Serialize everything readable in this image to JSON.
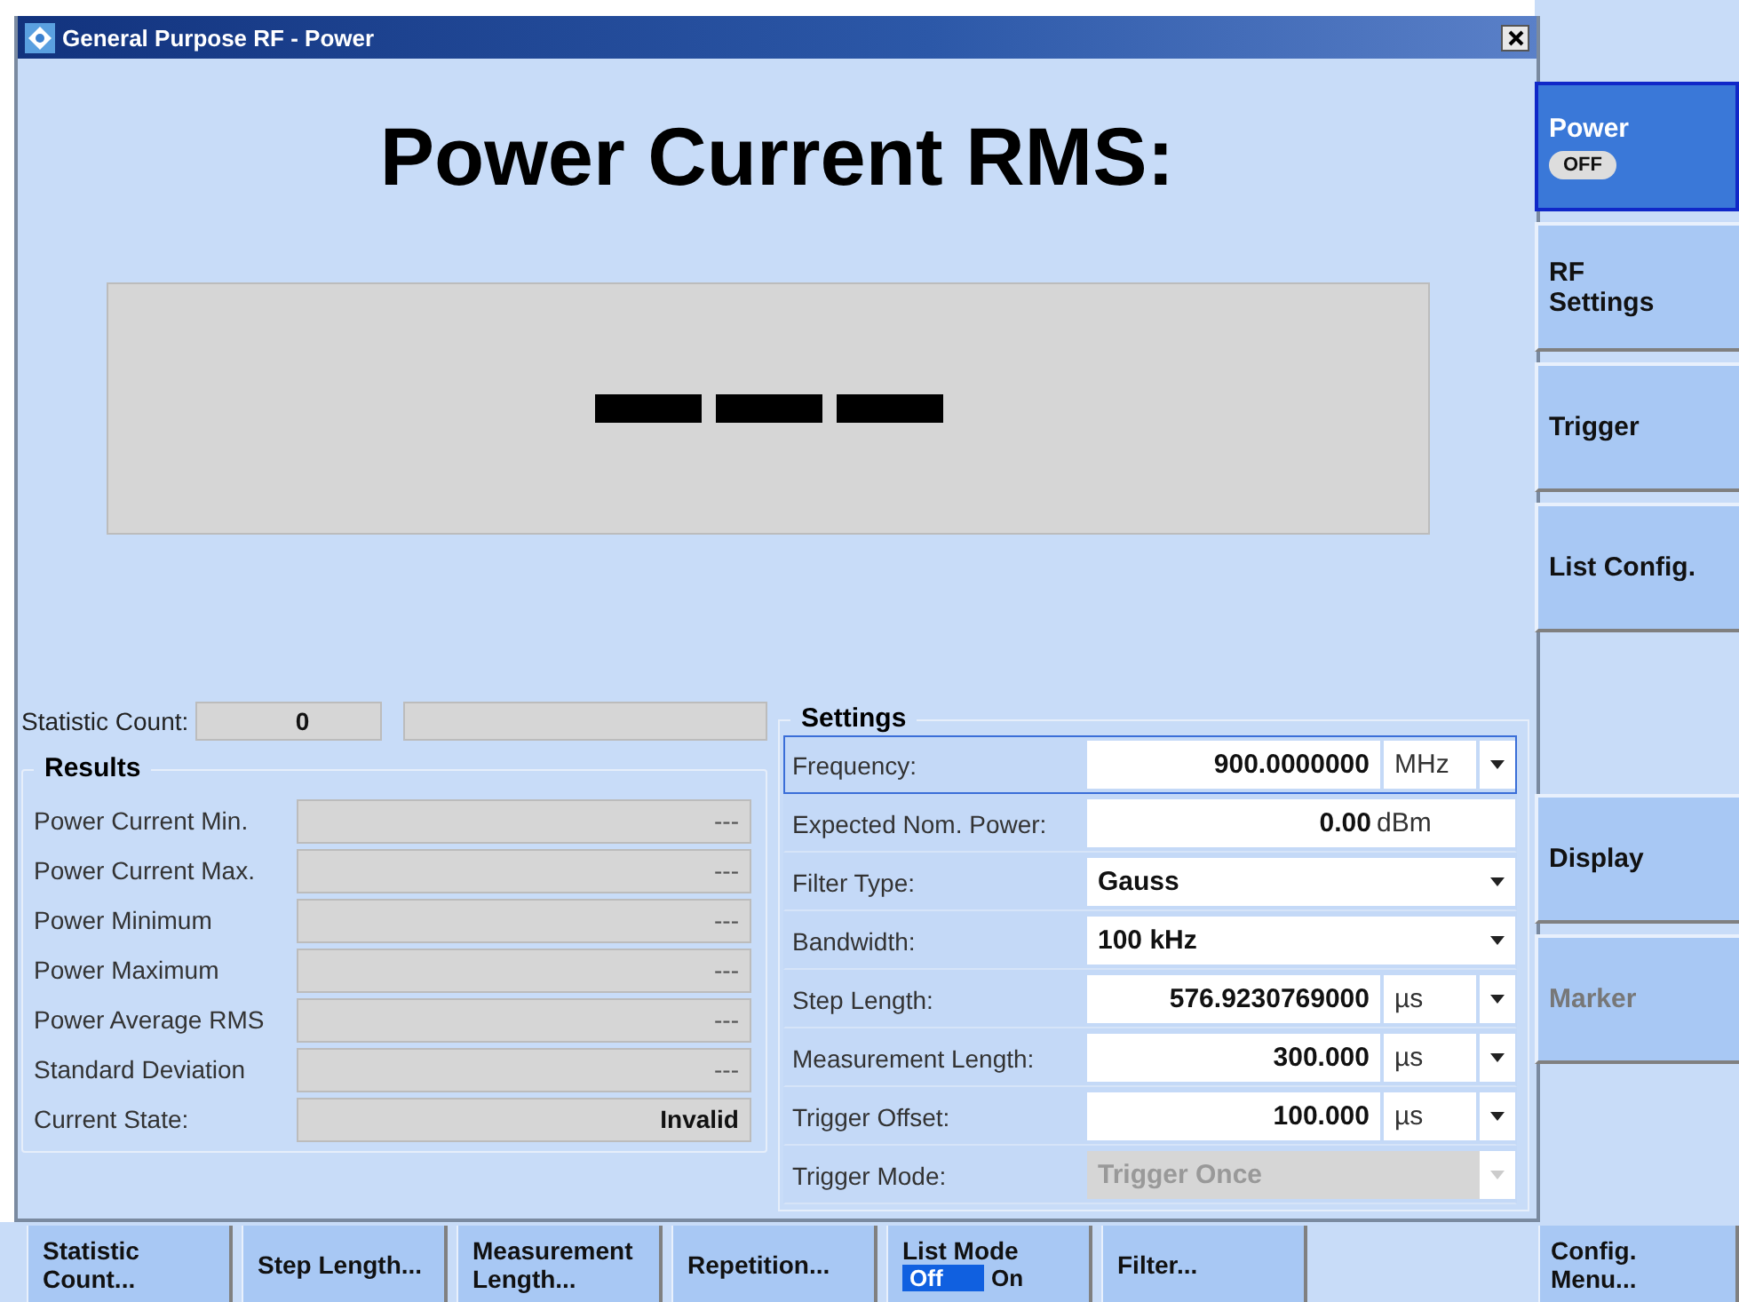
{
  "window": {
    "title": "General Purpose RF - Power"
  },
  "heading": "Power Current RMS:",
  "statistic_count": {
    "label": "Statistic Count:",
    "value": "0"
  },
  "results": {
    "title": "Results",
    "rows": [
      {
        "label": "Power Current Min.",
        "value": "---",
        "kind": "plain"
      },
      {
        "label": "Power Current Max.",
        "value": "---",
        "kind": "plain"
      },
      {
        "label": "Power Minimum",
        "value": "---",
        "kind": "plain"
      },
      {
        "label": "Power Maximum",
        "value": "---",
        "kind": "plain"
      },
      {
        "label": "Power Average RMS",
        "value": "---",
        "kind": "plain"
      },
      {
        "label": "Standard Deviation",
        "value": "---",
        "kind": "plain"
      },
      {
        "label": "Current State:",
        "value": "Invalid",
        "kind": "bold"
      }
    ]
  },
  "settings": {
    "title": "Settings",
    "rows": [
      {
        "label": "Frequency:",
        "kind": "number_unit",
        "value": "900.0000000",
        "unit": "MHz",
        "focused": true,
        "disabled": false
      },
      {
        "label": "Expected Nom. Power:",
        "kind": "number_fixed",
        "value": "0.00",
        "unit": "dBm",
        "focused": false,
        "disabled": false
      },
      {
        "label": "Filter Type:",
        "kind": "select",
        "value": "Gauss",
        "focused": false,
        "disabled": false
      },
      {
        "label": "Bandwidth:",
        "kind": "select",
        "value": "100 kHz",
        "focused": false,
        "disabled": false
      },
      {
        "label": "Step Length:",
        "kind": "number_unit",
        "value": "576.9230769000",
        "unit": "µs",
        "focused": false,
        "disabled": false
      },
      {
        "label": "Measurement Length:",
        "kind": "number_unit",
        "value": "300.000",
        "unit": "µs",
        "focused": false,
        "disabled": false
      },
      {
        "label": "Trigger Offset:",
        "kind": "number_unit",
        "value": "100.000",
        "unit": "µs",
        "focused": false,
        "disabled": false
      },
      {
        "label": "Trigger Mode:",
        "kind": "select",
        "value": "Trigger Once",
        "focused": false,
        "disabled": true
      }
    ]
  },
  "softkeys_top": [
    {
      "label": "Power",
      "toggle": "OFF",
      "selected": true,
      "disabled": false
    },
    {
      "label": "RF\nSettings",
      "selected": false,
      "disabled": false
    },
    {
      "label": "Trigger",
      "selected": false,
      "disabled": false
    },
    {
      "label": "List Config.",
      "selected": false,
      "disabled": false
    }
  ],
  "softkeys_bottom": [
    {
      "label": "Display",
      "selected": false,
      "disabled": false
    },
    {
      "label": "Marker",
      "selected": false,
      "disabled": true
    }
  ],
  "bottom_keys": [
    {
      "kind": "button",
      "label": "Statistic\nCount..."
    },
    {
      "kind": "button",
      "label": "Step Length..."
    },
    {
      "kind": "button",
      "label": "Measurement\nLength..."
    },
    {
      "kind": "button",
      "label": "Repetition..."
    },
    {
      "kind": "toggle",
      "label": "List Mode",
      "options": [
        {
          "label": "Off",
          "selected": true
        },
        {
          "label": "On",
          "selected": false
        }
      ]
    },
    {
      "kind": "button",
      "label": "Filter..."
    }
  ],
  "config_key": {
    "label": "Config. Menu..."
  }
}
